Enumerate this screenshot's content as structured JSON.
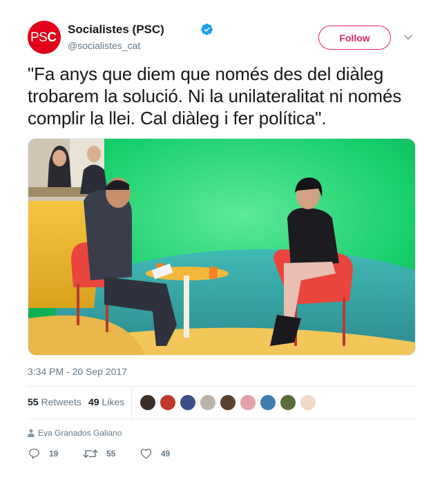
{
  "user": {
    "display_name": "Socialistes (PSC)",
    "handle": "@socialistes_cat",
    "avatar_text": "PS",
    "avatar_text_bold": "C"
  },
  "follow_label": "Follow",
  "tweet": {
    "text": "\"Fa anys que diem que només des del diàleg trobarem la solució. Ni la unilateralitat ni només complir la llei. Cal diàleg i fer política\".",
    "timestamp": "3:34 PM - 20 Sep 2017"
  },
  "stats": {
    "retweets_count": "55",
    "retweets_label": "Retweets",
    "likes_count": "49",
    "likes_label": "Likes"
  },
  "context": {
    "text": "Eva Granados Galiano"
  },
  "actions": {
    "replies": "19",
    "retweets": "55",
    "likes": "49"
  },
  "colors": {
    "brand": "#e2001a",
    "follow": "#e0245e",
    "verified": "#1da1f2",
    "muted": "#657786"
  },
  "icons": [
    "verified-badge-icon",
    "chevron-down-icon",
    "person-icon",
    "reply-icon",
    "retweet-icon",
    "heart-icon"
  ]
}
